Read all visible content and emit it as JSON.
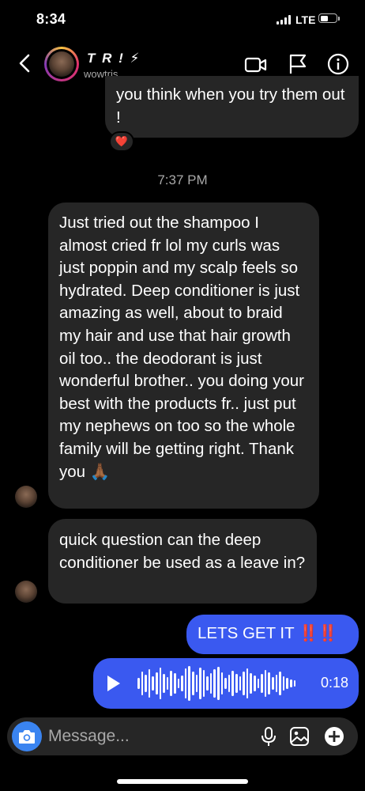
{
  "status_bar": {
    "time": "8:34",
    "network": "LTE",
    "battery_level": 0.55
  },
  "header": {
    "name": "T R ! ⚡",
    "handle": "wowtris"
  },
  "messages": {
    "partial_text": "you think when you try them out !",
    "reaction": "❤️",
    "timestamp": "7:37 PM",
    "msg1": "Just tried out the shampoo I almost cried fr lol my curls was just poppin and my scalp feels so hydrated. Deep conditioner is just amazing as well, about to braid my hair and use that hair growth oil too.. the deodorant is just wonderful brother.. you doing your best with the products fr.. just put my nephews on too so the whole family will be getting right. Thank you 🙏🏾",
    "msg2": "quick question can the deep conditioner be used as a leave in?",
    "msg3_text": "LETS GET IT",
    "msg3_emoji": "‼️‼️",
    "voice_duration": "0:18"
  },
  "composer": {
    "placeholder": "Message..."
  },
  "colors": {
    "outgoing": "#3a59f0",
    "incoming": "#262626",
    "camera": "#3a84f0"
  },
  "icons": [
    "back-icon",
    "video-call-icon",
    "flag-icon",
    "info-icon",
    "camera-icon",
    "microphone-icon",
    "gallery-icon",
    "add-icon",
    "play-icon"
  ]
}
